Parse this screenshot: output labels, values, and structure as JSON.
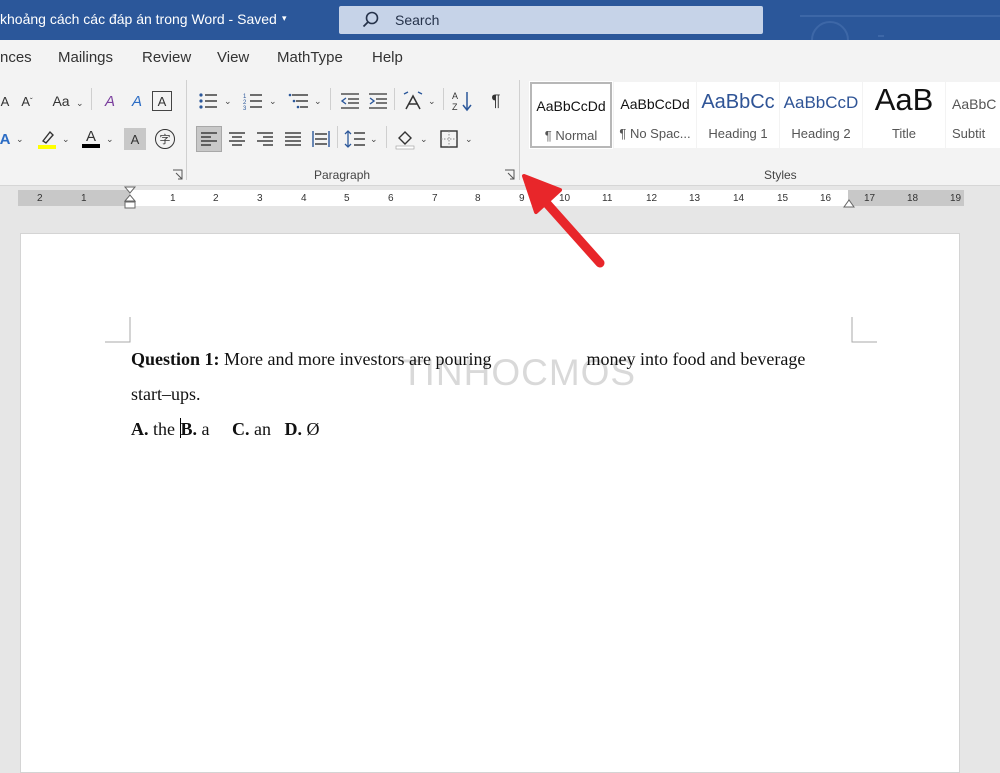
{
  "titlebar": {
    "doc_title": "khoảng cách các đáp án trong Word  -  Saved",
    "chevron": "▾",
    "search_placeholder": "Search",
    "search_icon": "search-icon",
    "bg_color": "#2b579a"
  },
  "tabs": [
    "nces",
    "Mailings",
    "Review",
    "View",
    "MathType",
    "Help"
  ],
  "ribbon": {
    "font_group": {
      "grow_font": "A",
      "shrink_font": "A",
      "change_case": "Aa",
      "clear_format": "A",
      "phonetic_guide": "A",
      "char_border": "A",
      "text_effects": "A",
      "font_color": "A",
      "char_shading": "A",
      "enclose_char": "字",
      "highlight_color": "#ffff00",
      "font_color_value": "#000000"
    },
    "paragraph_group": {
      "label": "Paragraph",
      "show_marks": "¶",
      "sort": "A↓Z"
    },
    "styles_group": {
      "label": "Styles",
      "items": [
        {
          "sample": "AaBbCcDd",
          "name": "¶ Normal"
        },
        {
          "sample": "AaBbCcDd",
          "name": "¶ No Spac..."
        },
        {
          "sample": "AaBbCc",
          "name": "Heading 1"
        },
        {
          "sample": "AaBbCcD",
          "name": "Heading 2"
        },
        {
          "sample": "AaB",
          "name": "Title"
        },
        {
          "sample": "AaBbC",
          "name": "Subtit"
        }
      ]
    }
  },
  "ruler": {
    "left_numbers": [
      "2",
      "1"
    ],
    "right_numbers": [
      "1",
      "2",
      "3",
      "4",
      "5",
      "6",
      "7",
      "8",
      "9",
      "10",
      "11",
      "12",
      "13",
      "14",
      "15",
      "16",
      "17",
      "18",
      "19"
    ]
  },
  "document": {
    "q_label": "Question 1:",
    "q_text_a": " More and more investors are pouring ",
    "q_text_b": " money into food and beverage start–ups.",
    "opt_a_label": "A.",
    "opt_a_text": " the ",
    "opt_b_label": "B.",
    "opt_b_text": " a",
    "opt_c_label": "C.",
    "opt_c_text": " an",
    "opt_d_label": "D.",
    "opt_d_text": " Ø",
    "watermark": "TINHOCMOS"
  },
  "colors": {
    "accent": "#2b579a",
    "arrow": "#e8262a"
  }
}
